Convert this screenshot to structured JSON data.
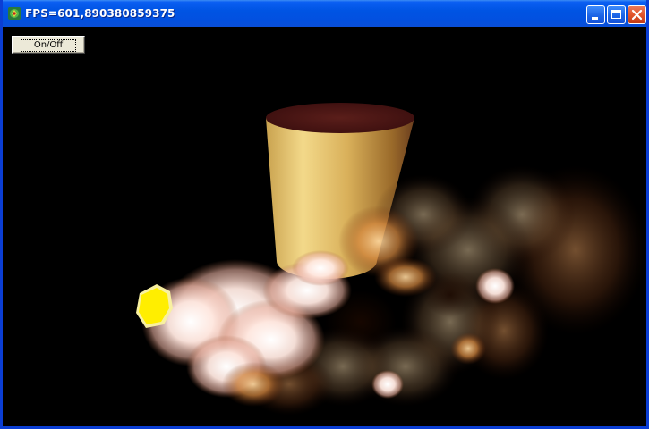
{
  "window": {
    "title": "FPS=601,890380859375"
  },
  "controls": {
    "toggle_label": "On/Off"
  },
  "icons": {
    "app": "application-icon",
    "minimize": "minimize-icon",
    "maximize": "maximize-icon",
    "close": "close-icon"
  },
  "colors": {
    "titlebar": "#0054e3",
    "background": "#000000",
    "cylinder": "#d9b560",
    "flame_core": "#fff8f0",
    "emitter": "#ffee00"
  }
}
